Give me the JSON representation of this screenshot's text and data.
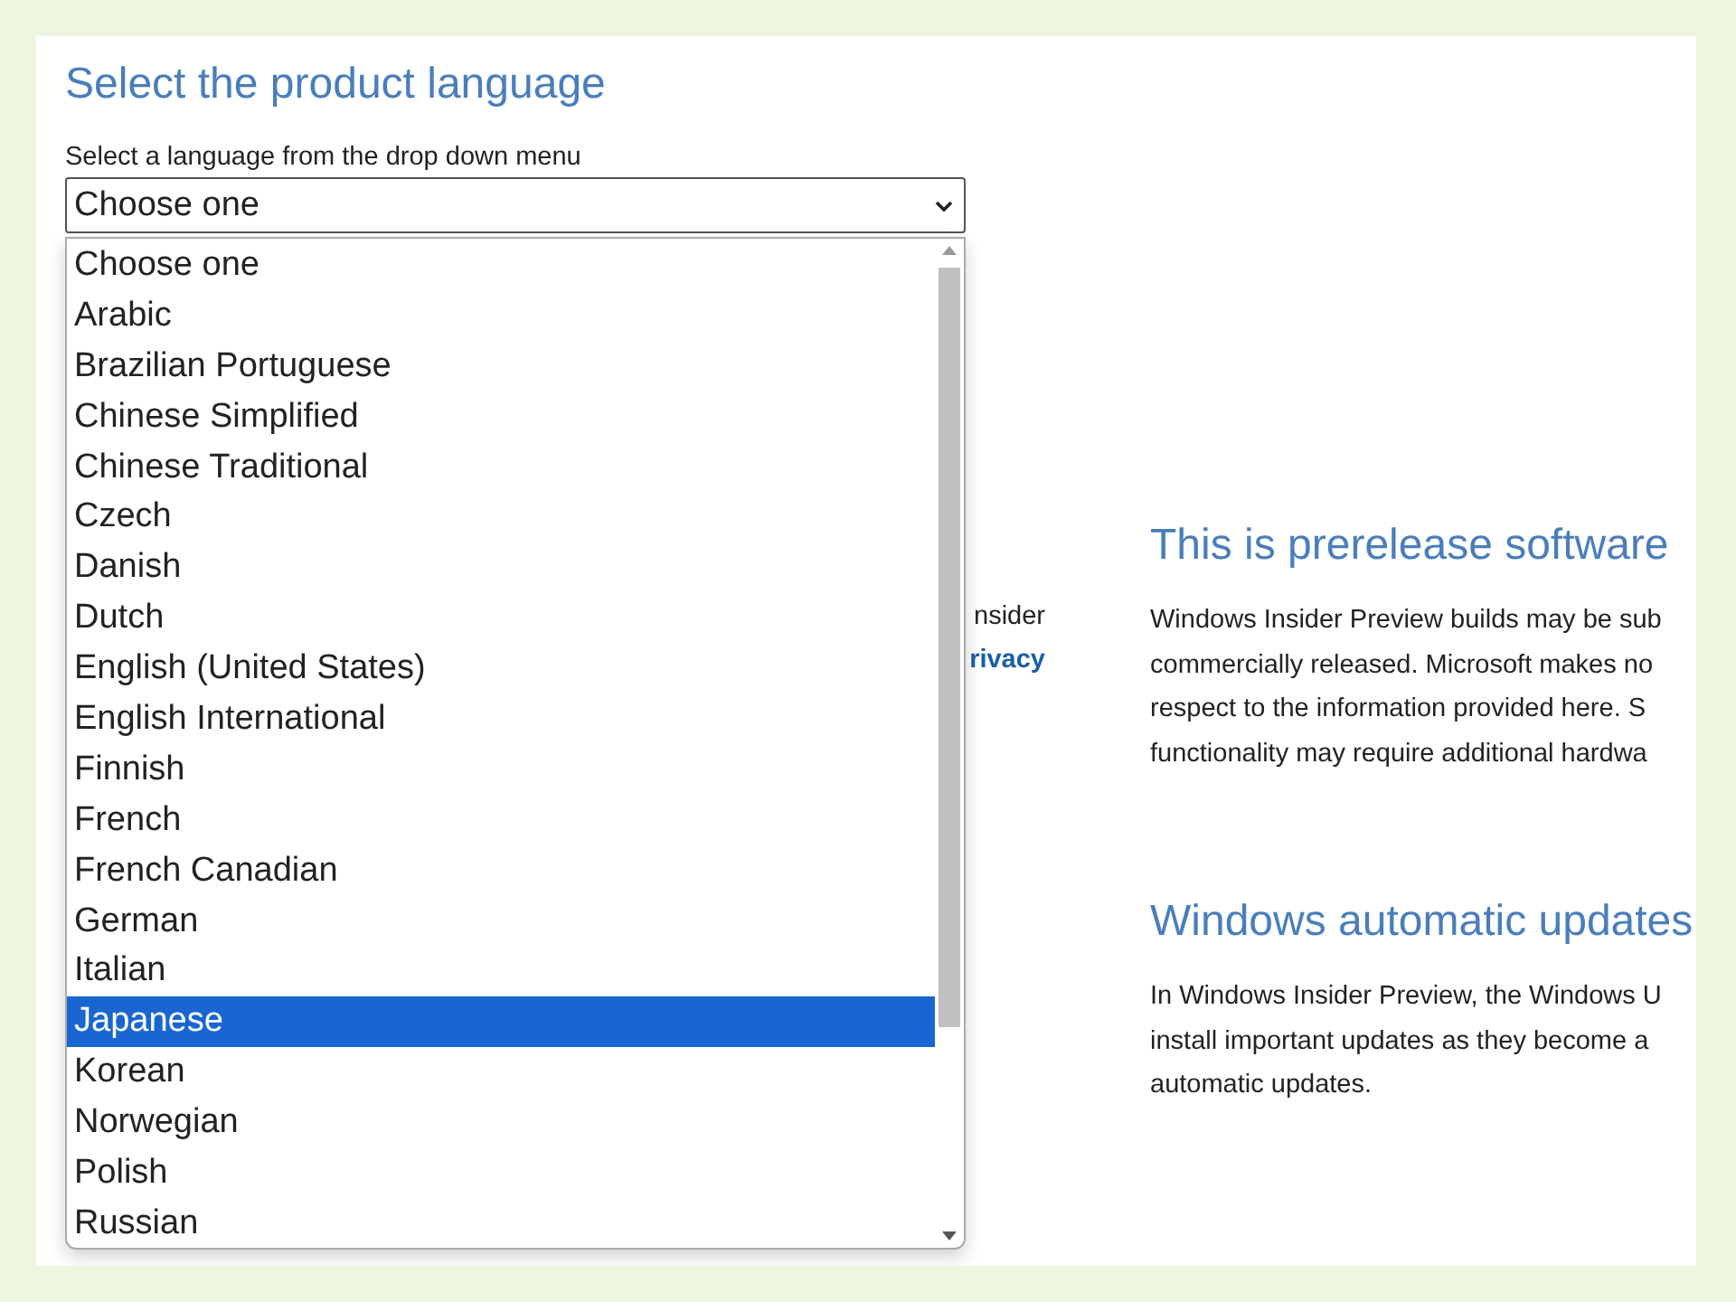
{
  "left": {
    "heading": "Select the product language",
    "label": "Select a language from the drop down menu",
    "select": {
      "value": "Choose one",
      "expanded": true
    },
    "options": [
      {
        "label": "Choose one",
        "selected": false
      },
      {
        "label": "Arabic",
        "selected": false
      },
      {
        "label": "Brazilian Portuguese",
        "selected": false
      },
      {
        "label": "Chinese Simplified",
        "selected": false
      },
      {
        "label": "Chinese Traditional",
        "selected": false
      },
      {
        "label": "Czech",
        "selected": false
      },
      {
        "label": "Danish",
        "selected": false
      },
      {
        "label": "Dutch",
        "selected": false
      },
      {
        "label": "English (United States)",
        "selected": false
      },
      {
        "label": "English International",
        "selected": false
      },
      {
        "label": "Finnish",
        "selected": false
      },
      {
        "label": "French",
        "selected": false
      },
      {
        "label": "French Canadian",
        "selected": false
      },
      {
        "label": "German",
        "selected": false
      },
      {
        "label": "Italian",
        "selected": false
      },
      {
        "label": "Japanese",
        "selected": true
      },
      {
        "label": "Korean",
        "selected": false
      },
      {
        "label": "Norwegian",
        "selected": false
      },
      {
        "label": "Polish",
        "selected": false
      },
      {
        "label": "Russian",
        "selected": false
      }
    ],
    "covered_text": "nsider",
    "covered_link": "rivacy"
  },
  "right": {
    "sections": [
      {
        "heading": "This is prerelease software",
        "lines": [
          "Windows Insider Preview builds may be sub",
          "commercially released. Microsoft makes no",
          "respect to the information provided here. S",
          "functionality may require additional hardwa"
        ]
      },
      {
        "heading": "Windows automatic updates",
        "lines": [
          "In Windows Insider Preview, the Windows U",
          "install important updates as they become a",
          "automatic updates."
        ]
      }
    ]
  }
}
